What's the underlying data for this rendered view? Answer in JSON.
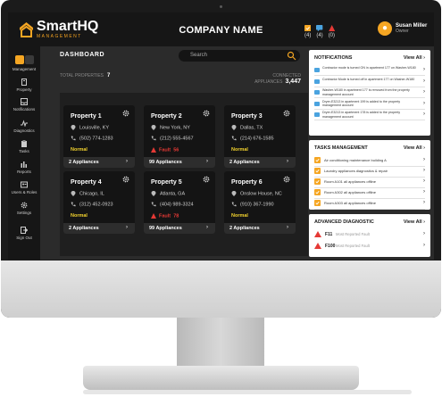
{
  "header": {
    "logo_main": "Smart",
    "logo_bold": "HQ",
    "logo_sub": "MANAGEMENT",
    "company": "COMPANY NAME",
    "counts": [
      "(4)",
      "(4)",
      "(0)"
    ],
    "user_name": "Susan Miller",
    "user_role": "Owner"
  },
  "sidebar": {
    "items": [
      {
        "label": "Management",
        "icon": "grid-icon"
      },
      {
        "label": "Property",
        "icon": "building-icon"
      },
      {
        "label": "Notifications",
        "icon": "inbox-icon"
      },
      {
        "label": "Diagnostics",
        "icon": "pulse-icon"
      },
      {
        "label": "Tasks",
        "icon": "clipboard-icon"
      },
      {
        "label": "Reports",
        "icon": "bar-chart-icon"
      },
      {
        "label": "Users & Roles",
        "icon": "users-icon"
      },
      {
        "label": "Settings",
        "icon": "gear-icon"
      },
      {
        "label": "Sign Out",
        "icon": "sign-out-icon"
      }
    ]
  },
  "main": {
    "title": "DASHBOARD",
    "search_placeholder": "Search",
    "total_label": "TOTAL PROPERTIES",
    "total_value": "7",
    "connected_label": "CONNECTED APPLIANCES",
    "connected_value": "3,447"
  },
  "properties": [
    {
      "name": "Property 1",
      "city": "Louisville, KY",
      "phone": "(502) 774-1283",
      "status": "Normal",
      "fault": false,
      "appliances": "2 Appliances"
    },
    {
      "name": "Property 2",
      "city": "New York, NY",
      "phone": "(212) 555-4567",
      "status": "Fault",
      "fault_count": "56",
      "fault": true,
      "appliances": "99 Appliances"
    },
    {
      "name": "Property 3",
      "city": "Dallas, TX",
      "phone": "(214) 676-1585",
      "status": "Normal",
      "fault": false,
      "appliances": "2 Appliances"
    },
    {
      "name": "Property 4",
      "city": "Chicago, IL",
      "phone": "(312) 452-0923",
      "status": "Normal",
      "fault": false,
      "appliances": "2 Appliances"
    },
    {
      "name": "Property 5",
      "city": "Atlanta, GA",
      "phone": "(404) 989-3324",
      "status": "Fault",
      "fault_count": "78",
      "fault": true,
      "appliances": "99 Appliances"
    },
    {
      "name": "Property 6",
      "city": "Onslow House, NC",
      "phone": "(910) 367-1990",
      "status": "Normal",
      "fault": false,
      "appliances": "2 Appliances"
    }
  ],
  "notifications": {
    "title": "NOTIFICATIONS",
    "view_all": "View All",
    "items": [
      "Contractor mode is turned ON in apartment 177 on Washer-W180",
      "Contractor Mode is turned off in apartment 177 on Washer-W180",
      "Washer-W180 in apartment 177 is removed from the property management account",
      "Dryer-E3213 in apartment 199 is added to the property management account",
      "Dryer-E3213 in apartment 178 is added to the property management account"
    ]
  },
  "tasks": {
    "title": "TASKS MANAGEMENT",
    "view_all": "View All",
    "items": [
      "Air conditioning maintenance building A",
      "Laundry appliances diagnostics & repair",
      "Room A101 all appliances offline",
      "Room A302 all appliances offline",
      "Room A303 all appliances offline"
    ]
  },
  "diagnostic": {
    "title": "ADVANCED DIAGNOSTIC",
    "view_all": "View All",
    "items": [
      {
        "code": "F11",
        "desc": "Most Reported Fault"
      },
      {
        "code": "F100",
        "desc": "Most Reported Fault"
      }
    ]
  },
  "colors": {
    "accent": "#f5a623",
    "fault": "#e53935",
    "normal": "#f2d22e"
  }
}
